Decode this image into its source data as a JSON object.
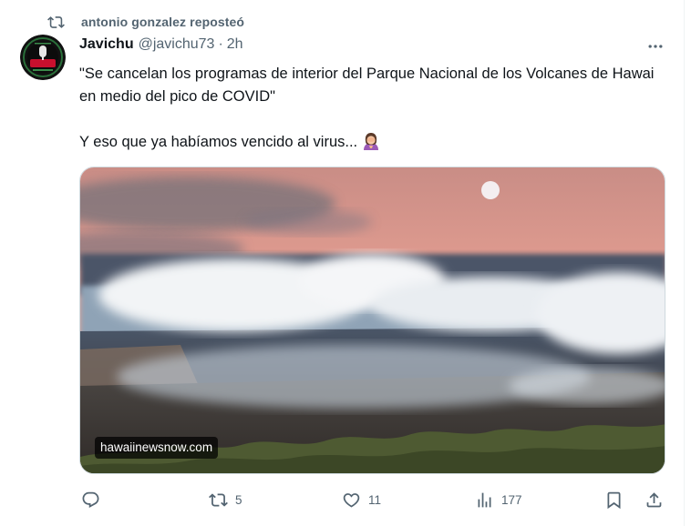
{
  "repost": {
    "text": "antonio gonzalez reposteó",
    "icon": "repost-icon"
  },
  "tweet": {
    "author_name": "Javichu",
    "author_handle": "@javichu73",
    "separator": "·",
    "time": "2h",
    "avatar_icon": "avatar-logo-icon",
    "text_line_1": "\"Se cancelan los programas de interior del Parque Nacional de los Volcanes de Hawai en medio del pico de COVID\"",
    "text_line_2": "Y eso que ya habíamos vencido al virus...",
    "emoji": "woman-facepalming-emoji",
    "more_icon": "more-options-icon"
  },
  "media": {
    "source": "hawaiinewsnow.com",
    "description_icon": "volcano-crater-photo"
  },
  "actions": {
    "reply": {
      "icon": "reply-icon",
      "count": ""
    },
    "repost": {
      "icon": "repost-icon",
      "count": "5"
    },
    "like": {
      "icon": "heart-icon",
      "count": "11"
    },
    "views": {
      "icon": "views-chart-icon",
      "count": "177"
    },
    "bookmark": {
      "icon": "bookmark-icon"
    },
    "share": {
      "icon": "share-icon"
    }
  },
  "colors": {
    "text_primary": "#0f1419",
    "text_secondary": "#536471",
    "border": "#cfd9de"
  }
}
